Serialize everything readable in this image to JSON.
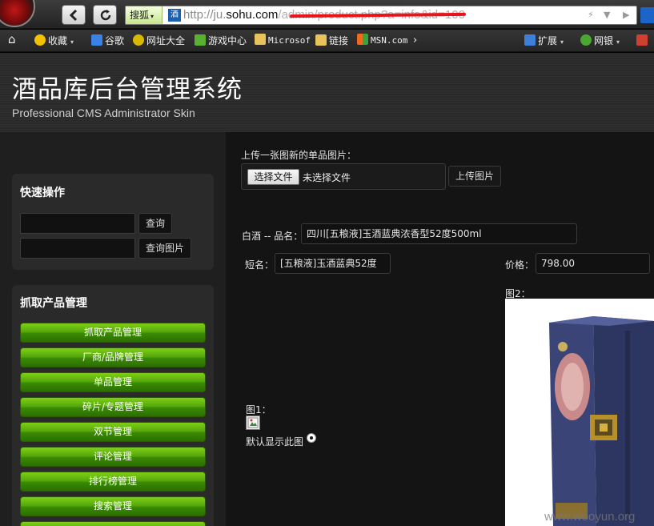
{
  "browser": {
    "search_engine": "搜狐",
    "url_prefix": "http://ju.",
    "url_host": "sohu.com",
    "url_rest": "/admin/product.php?a=info&id=100"
  },
  "bookmarks": [
    {
      "label": "收藏",
      "icon": "star-icon",
      "color": "#f2c200",
      "dropdown": true
    },
    {
      "label": "谷歌",
      "icon": "google-icon",
      "color": "#3b82e6"
    },
    {
      "label": "网址大全",
      "icon": "plus-circle-icon",
      "color": "#d9b800"
    },
    {
      "label": "游戏中心",
      "icon": "game-icon",
      "color": "#5ab030"
    },
    {
      "label": "Microsof",
      "icon": "folder-icon",
      "color": "#e8c25a"
    },
    {
      "label": "链接",
      "icon": "folder-icon",
      "color": "#e8c25a"
    },
    {
      "label": "MSN.com",
      "icon": "msn-icon",
      "color": "#f06a1c"
    }
  ],
  "toolbar_right": [
    {
      "label": "扩展",
      "icon": "extensions-icon",
      "color": "#3e7fd8"
    },
    {
      "label": "网银",
      "icon": "bank-icon",
      "color": "#4aa832"
    }
  ],
  "header": {
    "title": "酒品库后台管理系统",
    "subtitle": "Professional CMS Administrator Skin"
  },
  "sidebar": {
    "quick_title": "快速操作",
    "query_btn": "查询",
    "query_image_btn": "查询图片",
    "grab_title": "抓取产品管理",
    "menu": [
      "抓取产品管理",
      "厂商/品牌管理",
      "单品管理",
      "碎片/专题管理",
      "双节管理",
      "评论管理",
      "排行榜管理",
      "搜索管理"
    ]
  },
  "main": {
    "upload_label": "上传一张图新的单品图片：",
    "choose_file_btn": "选择文件",
    "no_file_text": "未选择文件",
    "upload_btn": "上传图片",
    "category_label": "白酒 -- 品名：",
    "product_name": "四川[五粮液]玉酒蓝典浓香型52度500ml",
    "short_name_label": "短名：",
    "short_name": "[五粮液]玉酒蓝典52度",
    "price_label": "价格：",
    "price": "798.00",
    "pic2_label": "图2：",
    "pic1_label": "图1：",
    "default_display_label": "默认显示此图"
  },
  "watermark": "www.wooyun.org",
  "colors": {
    "accent_green": "#56a80c",
    "redaction_red": "#e8141c",
    "panel_dark": "#141414"
  }
}
